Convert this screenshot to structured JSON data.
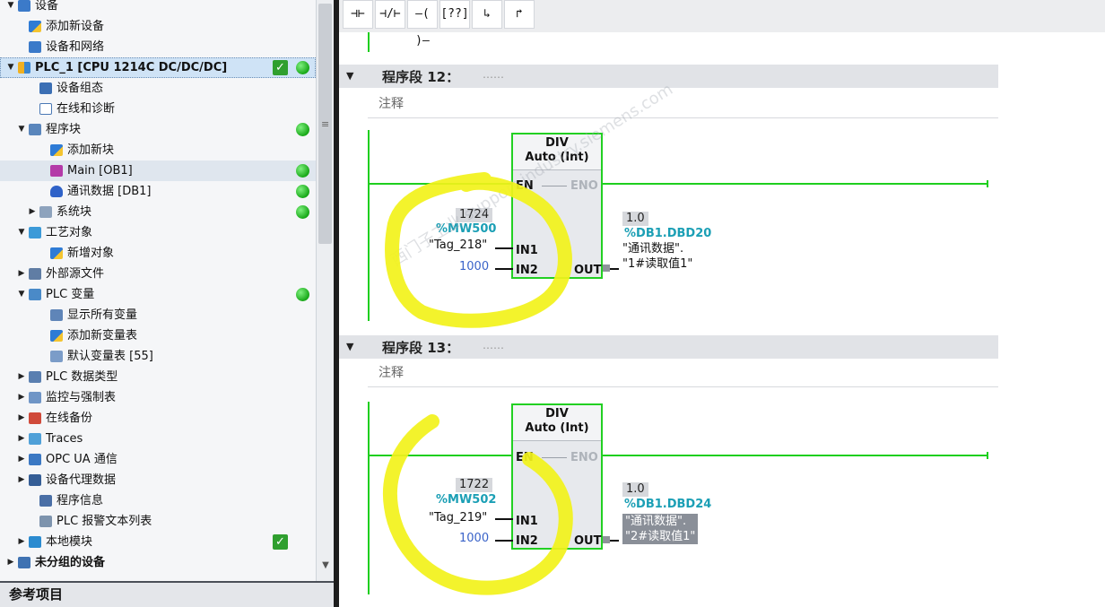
{
  "project_tree": {
    "items": [
      {
        "label": "设备",
        "level": 0,
        "twisty": "▼",
        "icon": "folder-icon",
        "cls": "ic-net"
      },
      {
        "label": "添加新设备",
        "level": 1,
        "twisty": "",
        "icon": "add-device-icon",
        "cls": "ic-new"
      },
      {
        "label": "设备和网络",
        "level": 1,
        "twisty": "",
        "icon": "network-icon",
        "cls": "ic-net"
      },
      {
        "label": "PLC_1 [CPU 1214C DC/DC/DC]",
        "level": 0,
        "twisty": "▼",
        "icon": "plc-icon",
        "cls": "ic-plc",
        "bold": true,
        "selected": true,
        "check": true,
        "status": true
      },
      {
        "label": "设备组态",
        "level": 2,
        "twisty": "",
        "icon": "device-config-icon",
        "cls": "ic-conf"
      },
      {
        "label": "在线和诊断",
        "level": 2,
        "twisty": "",
        "icon": "diagnostics-icon",
        "cls": "ic-diag"
      },
      {
        "label": "程序块",
        "level": 1,
        "twisty": "▼",
        "icon": "program-blocks-icon",
        "cls": "ic-blk",
        "status": true
      },
      {
        "label": "添加新块",
        "level": 3,
        "twisty": "",
        "icon": "add-block-icon",
        "cls": "ic-new"
      },
      {
        "label": "Main [OB1]",
        "level": 3,
        "twisty": "",
        "icon": "ob-icon",
        "cls": "ic-ob",
        "highlight": true,
        "status": true
      },
      {
        "label": "通讯数据 [DB1]",
        "level": 3,
        "twisty": "",
        "icon": "db-icon",
        "cls": "ic-db",
        "status": true
      },
      {
        "label": "系统块",
        "level": 2,
        "twisty": "▶",
        "icon": "system-blocks-icon",
        "cls": "ic-sys",
        "status": true
      },
      {
        "label": "工艺对象",
        "level": 1,
        "twisty": "▼",
        "icon": "technology-objects-icon",
        "cls": "ic-tech"
      },
      {
        "label": "新增对象",
        "level": 3,
        "twisty": "",
        "icon": "add-object-icon",
        "cls": "ic-new"
      },
      {
        "label": "外部源文件",
        "level": 1,
        "twisty": "▶",
        "icon": "external-source-icon",
        "cls": "ic-ext"
      },
      {
        "label": "PLC 变量",
        "level": 1,
        "twisty": "▼",
        "icon": "plc-tags-icon",
        "cls": "ic-tag",
        "status": true
      },
      {
        "label": "显示所有变量",
        "level": 3,
        "twisty": "",
        "icon": "show-all-tags-icon",
        "cls": "ic-show"
      },
      {
        "label": "添加新变量表",
        "level": 3,
        "twisty": "",
        "icon": "add-tag-table-icon",
        "cls": "ic-new"
      },
      {
        "label": "默认变量表 [55]",
        "level": 3,
        "twisty": "",
        "icon": "tag-table-icon",
        "cls": "ic-tbl"
      },
      {
        "label": "PLC 数据类型",
        "level": 1,
        "twisty": "▶",
        "icon": "plc-data-types-icon",
        "cls": "ic-type"
      },
      {
        "label": "监控与强制表",
        "level": 1,
        "twisty": "▶",
        "icon": "watch-table-icon",
        "cls": "ic-watch"
      },
      {
        "label": "在线备份",
        "level": 1,
        "twisty": "▶",
        "icon": "online-backup-icon",
        "cls": "ic-backup"
      },
      {
        "label": "Traces",
        "level": 1,
        "twisty": "▶",
        "icon": "traces-icon",
        "cls": "ic-trace"
      },
      {
        "label": "OPC UA 通信",
        "level": 1,
        "twisty": "▶",
        "icon": "opc-ua-icon",
        "cls": "ic-opc"
      },
      {
        "label": "设备代理数据",
        "level": 1,
        "twisty": "▶",
        "icon": "device-proxy-icon",
        "cls": "ic-proxy"
      },
      {
        "label": "程序信息",
        "level": 2,
        "twisty": "",
        "icon": "program-info-icon",
        "cls": "ic-info"
      },
      {
        "label": "PLC 报警文本列表",
        "level": 2,
        "twisty": "",
        "icon": "alarm-text-icon",
        "cls": "ic-alarm"
      },
      {
        "label": "本地模块",
        "level": 1,
        "twisty": "▶",
        "icon": "local-modules-icon",
        "cls": "ic-local",
        "check": true
      },
      {
        "label": "未分组的设备",
        "level": 0,
        "twisty": "▶",
        "icon": "ungrouped-devices-icon",
        "cls": "ic-ungroup",
        "bold": true
      }
    ],
    "reference_projects": "参考项目"
  },
  "toolbar": {
    "buttons": [
      {
        "name": "no-contact-button",
        "glyph": "⊣⊢"
      },
      {
        "name": "nc-contact-button",
        "glyph": "⊣/⊢"
      },
      {
        "name": "coil-button",
        "glyph": "–( )–"
      },
      {
        "name": "empty-box-button",
        "glyph": "[??]"
      },
      {
        "name": "open-branch-button",
        "glyph": "↳"
      },
      {
        "name": "close-branch-button",
        "glyph": "↱"
      }
    ]
  },
  "networks": [
    {
      "title": "程序段 12：",
      "dots": "……",
      "comment": "注释",
      "block": {
        "name": "DIV",
        "type": "Auto (Int)",
        "en": "EN",
        "eno": "ENO",
        "in1": "IN1",
        "in2": "IN2",
        "out": "OUT"
      },
      "in1": {
        "value": "1724",
        "address": "%MW500",
        "name": "\"Tag_218\""
      },
      "in2": {
        "constant": "1000"
      },
      "out": {
        "value": "1.0",
        "address": "%DB1.DBD20",
        "line1": "\"通讯数据\".",
        "line2": "\"1#读取值1\"",
        "selected": false
      }
    },
    {
      "title": "程序段 13：",
      "dots": "……",
      "comment": "注释",
      "block": {
        "name": "DIV",
        "type": "Auto (Int)",
        "en": "EN",
        "eno": "ENO",
        "in1": "IN1",
        "in2": "IN2",
        "out": "OUT"
      },
      "in1": {
        "value": "1722",
        "address": "%MW502",
        "name": "\"Tag_219\""
      },
      "in2": {
        "constant": "1000"
      },
      "out": {
        "value": "1.0",
        "address": "%DB1.DBD24",
        "line1": "\"通讯数据\".",
        "line2": "\"2#读取值1\"",
        "selected": true
      }
    }
  ],
  "watermark": "西门子工业 support.industry.siemens.com",
  "colors": {
    "rail": "#1ecf1e",
    "annotation": "#f2f21a",
    "address": "#1b9fb5",
    "constant": "#3a63c9"
  }
}
